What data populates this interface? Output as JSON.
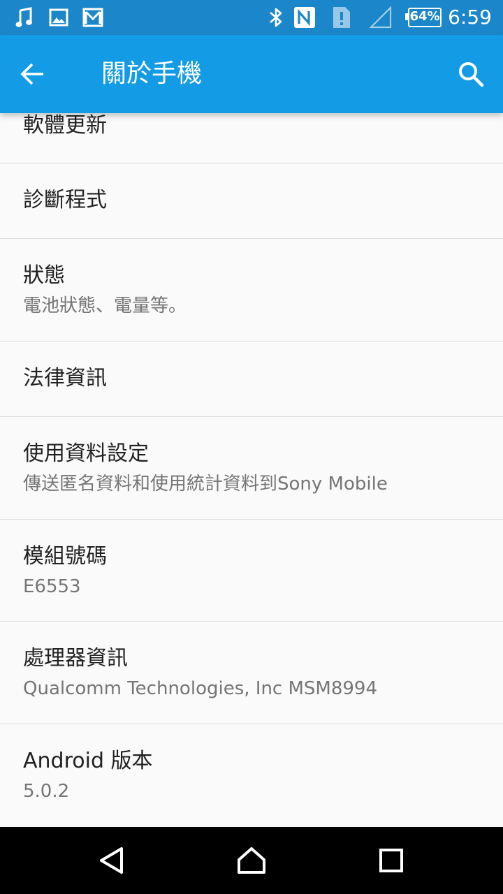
{
  "status_bar": {
    "icons_left": [
      "music-note-icon",
      "image-icon",
      "gmail-icon"
    ],
    "icons_right": [
      "bluetooth-icon",
      "nfc-icon",
      "sim-alert-icon",
      "signal-icon"
    ],
    "battery": "64%",
    "time": "6:59"
  },
  "app_bar": {
    "title": "關於手機",
    "back_icon": "arrow-left-icon",
    "search_icon": "search-icon"
  },
  "items": [
    {
      "title": "軟體更新",
      "subtitle": ""
    },
    {
      "title": "診斷程式",
      "subtitle": ""
    },
    {
      "title": "狀態",
      "subtitle": "電池狀態、電量等。"
    },
    {
      "title": "法律資訊",
      "subtitle": ""
    },
    {
      "title": "使用資料設定",
      "subtitle": "傳送匿名資料和使用統計資料到Sony Mobile"
    },
    {
      "title": "模組號碼",
      "subtitle": "E6553"
    },
    {
      "title": "處理器資訊",
      "subtitle": "Qualcomm Technologies, Inc MSM8994"
    },
    {
      "title": "Android 版本",
      "subtitle": "5.0.2"
    }
  ],
  "nav_bar": {
    "back": "triangle-back-icon",
    "home": "home-icon",
    "recents": "recents-icon"
  },
  "colors": {
    "status_bar": "#1b86c9",
    "app_bar": "#139be6",
    "background": "#fafafa",
    "divider": "#dcdcdc",
    "title_text": "#212121",
    "subtitle_text": "#757575"
  }
}
